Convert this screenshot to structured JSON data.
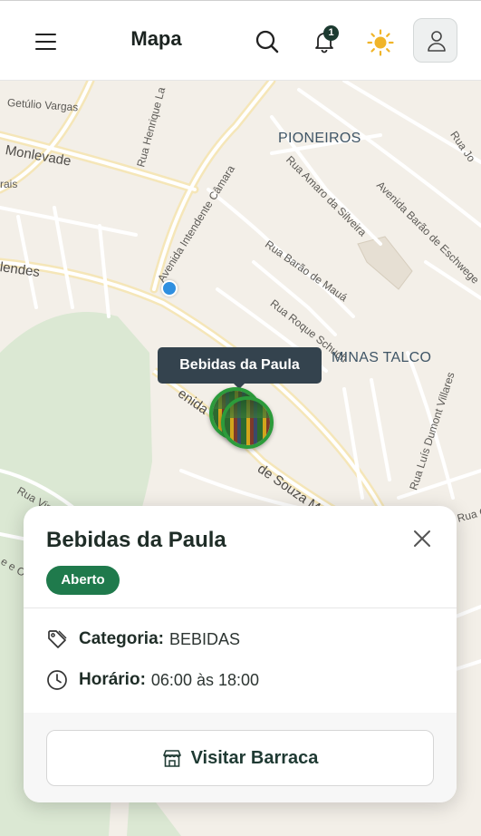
{
  "header": {
    "title": "Mapa",
    "notification_count": "1"
  },
  "map": {
    "labels": {
      "getulio": "Getúlio Vargas",
      "monlevade": "Monlevade",
      "rais": "rais",
      "mendes": "lendes",
      "henrique": "Rua Henrique La",
      "intendente": "Avenida Intendente Câmara",
      "pioneiros": "PIONEIROS",
      "amaro": "Rua Amaro da Silveira",
      "barao_eschwege": "Avenida Barão de Eschwege",
      "rua_jo": "Rua Jo",
      "barao_maua": "Rua Barão de Mauá",
      "roque": "Rua Roque Schuch",
      "minas_talco": "MINAS TALCO",
      "souza": "de Souza Mo",
      "avenida_fragment": "enida",
      "dumont": "Rua Luís Dumont Villares",
      "rua_vin": "Rua Vin",
      "rua_o": "Rua O",
      "rua_eo": "e e Ol"
    },
    "tooltip": "Bebidas da Paula"
  },
  "card": {
    "title": "Bebidas da Paula",
    "status": "Aberto",
    "category_label": "Categoria:",
    "category_value": "BEBIDAS",
    "hours_label": "Horário:",
    "hours_value": "06:00 às 18:00",
    "visit_button": "Visitar Barraca"
  },
  "colors": {
    "status_green": "#1f7a4c",
    "marker_ring": "#2c9b3b",
    "tooltip_bg": "#34434e",
    "location_dot": "#2f8fe0",
    "sun": "#f0b429"
  },
  "icons": [
    "menu-icon",
    "search-icon",
    "bell-icon",
    "sun-icon",
    "user-icon",
    "close-icon",
    "tag-icon",
    "clock-icon",
    "store-icon"
  ]
}
